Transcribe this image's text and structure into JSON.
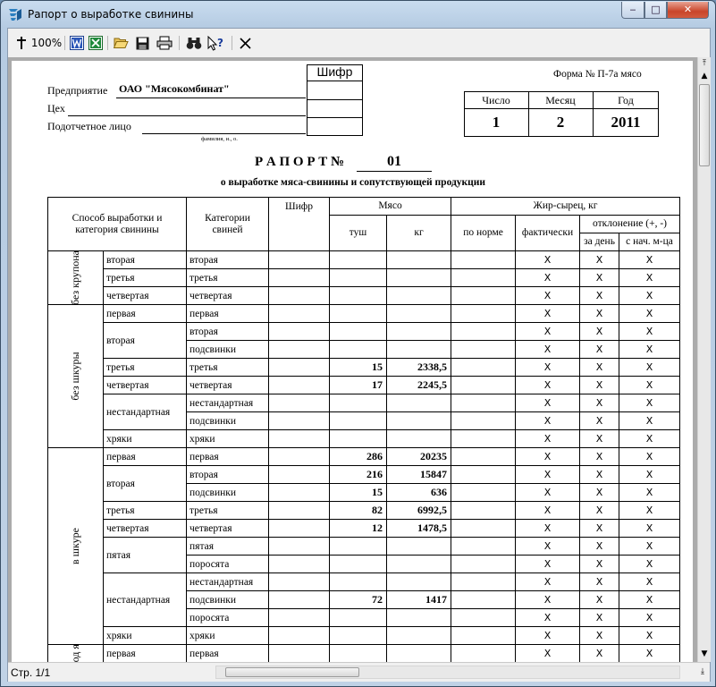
{
  "window": {
    "title": "Рапорт о выработке свинины",
    "min": "‒",
    "max": "□",
    "close": "✕"
  },
  "toolbar": {
    "zoom_label": "100%"
  },
  "statusbar": {
    "page": "Стр. 1/1"
  },
  "report": {
    "form_label": "Форма № П-7а мясо",
    "cipher_header": "Шифр",
    "enterprise_label": "Предприятие",
    "enterprise_value": "ОАО \"Мясокомбинат\"",
    "shop_label": "Цех",
    "person_label": "Подотчетное лицо",
    "person_hint": "фамилия, и., о.",
    "date": {
      "day_label": "Число",
      "month_label": "Месяц",
      "year_label": "Год",
      "day": "1",
      "month": "2",
      "year": "2011"
    },
    "title_prefix": "Р А П О Р Т №",
    "number": "01",
    "subtitle": "о выработке мяса-свинины и сопутствующей продукции",
    "headers": {
      "method": "Способ выработки и категория свинины",
      "categories": "Категории свиней",
      "cipher": "Шифр",
      "meat": "Мясо",
      "carcasses": "туш",
      "kg": "кг",
      "fat": "Жир-сырец, кг",
      "by_norm": "по норме",
      "actual": "фактически",
      "deviation": "отклонение (+, -)",
      "per_day": "за день",
      "since_month": "с нач. м-ца"
    },
    "x_mark": "X",
    "groups": [
      {
        "name": "без крупона",
        "rows": [
          {
            "method": "вторая",
            "category": "вторая",
            "carcasses": "",
            "kg": ""
          },
          {
            "method": "третья",
            "category": "третья",
            "carcasses": "",
            "kg": ""
          },
          {
            "method": "четвертая",
            "category": "четвертая",
            "carcasses": "",
            "kg": ""
          }
        ]
      },
      {
        "name": "без шкуры",
        "rows": [
          {
            "method": "первая",
            "category": "первая",
            "carcasses": "",
            "kg": ""
          },
          {
            "method": "вторая",
            "category": "вторая",
            "carcasses": "",
            "kg": ""
          },
          {
            "method": "",
            "category": "подсвинки",
            "carcasses": "",
            "kg": ""
          },
          {
            "method": "третья",
            "category": "третья",
            "carcasses": "15",
            "kg": "2338,5"
          },
          {
            "method": "четвертая",
            "category": "четвертая",
            "carcasses": "17",
            "kg": "2245,5"
          },
          {
            "method": "нестандартная",
            "category": "нестандартная",
            "carcasses": "",
            "kg": ""
          },
          {
            "method": "",
            "category": "подсвинки",
            "carcasses": "",
            "kg": ""
          },
          {
            "method": "хряки",
            "category": "хряки",
            "carcasses": "",
            "kg": ""
          }
        ]
      },
      {
        "name": "в шкуре",
        "rows": [
          {
            "method": "первая",
            "category": "первая",
            "carcasses": "286",
            "kg": "20235"
          },
          {
            "method": "вторая",
            "category": "вторая",
            "carcasses": "216",
            "kg": "15847"
          },
          {
            "method": "",
            "category": "подсвинки",
            "carcasses": "15",
            "kg": "636"
          },
          {
            "method": "третья",
            "category": "третья",
            "carcasses": "82",
            "kg": "6992,5"
          },
          {
            "method": "четвертая",
            "category": "четвертая",
            "carcasses": "12",
            "kg": "1478,5"
          },
          {
            "method": "пятая",
            "category": "пятая",
            "carcasses": "",
            "kg": ""
          },
          {
            "method": "",
            "category": "поросята",
            "carcasses": "",
            "kg": ""
          },
          {
            "method": "нестандартная",
            "category": "нестандартная",
            "carcasses": "",
            "kg": ""
          },
          {
            "method": "",
            "category": "подсвинки",
            "carcasses": "72",
            "kg": "1417"
          },
          {
            "method": "",
            "category": "поросята",
            "carcasses": "",
            "kg": ""
          },
          {
            "method": "хряки",
            "category": "хряки",
            "carcasses": "",
            "kg": ""
          }
        ]
      },
      {
        "name": "под як",
        "rows": [
          {
            "method": "первая",
            "category": "первая",
            "carcasses": "",
            "kg": ""
          }
        ]
      }
    ]
  }
}
